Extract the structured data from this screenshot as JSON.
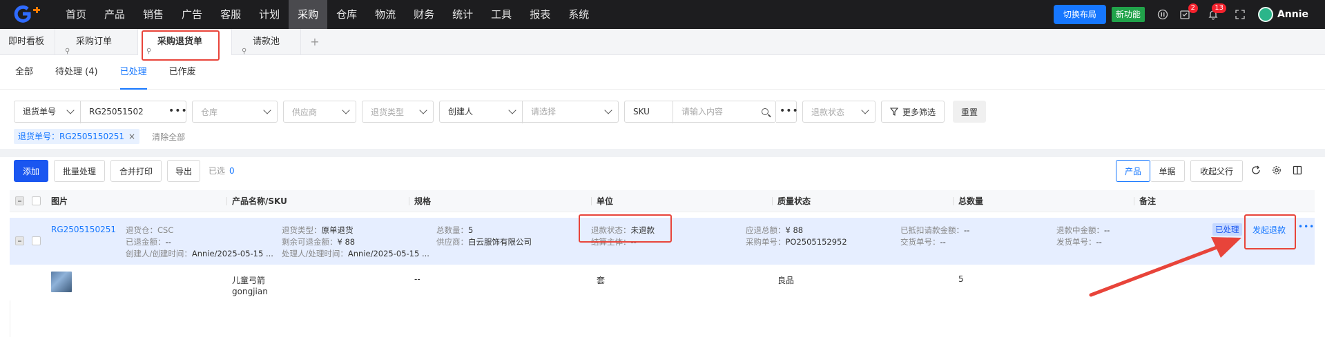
{
  "nav": {
    "items": [
      "首页",
      "产品",
      "销售",
      "广告",
      "客服",
      "计划",
      "采购",
      "仓库",
      "物流",
      "财务",
      "统计",
      "工具",
      "报表",
      "系统"
    ],
    "active_index": 6
  },
  "top_right": {
    "layout_btn": "切换布局",
    "new_feature": "新功能",
    "badge_tasks": "2",
    "badge_notices": "13",
    "user": "Annie"
  },
  "tabs": {
    "dashboard": "即时看板",
    "purchase_order": "采购订单",
    "purchase_return": "采购退货单",
    "payment_pool": "请款池",
    "plus": "+"
  },
  "subtabs": {
    "all": "全部",
    "pending": "待处理 (4)",
    "processed": "已处理",
    "voided": "已作废"
  },
  "filters": {
    "return_no_field": "退货单号",
    "return_no_value": "RG25051502",
    "dots": "•••",
    "warehouse": "仓库",
    "supplier": "供应商",
    "return_type": "退货类型",
    "creator": "创建人",
    "choose": "请选择",
    "sku": "SKU",
    "input_placeholder": "请输入内容",
    "refund_status": "退款状态",
    "more": "更多筛选",
    "reset": "重置"
  },
  "active_tag": {
    "label": "退货单号：RG2505150251",
    "close": "×",
    "clear_all": "清除全部"
  },
  "actions": {
    "add": "添加",
    "batch": "批量处理",
    "merge_print": "合并打印",
    "export": "导出",
    "selected_label": "已选",
    "selected_count": "0",
    "view_product": "产品",
    "view_order": "单据",
    "collapse": "收起父行"
  },
  "table": {
    "headers": [
      "图片",
      "产品名称/SKU",
      "规格",
      "单位",
      "质量状态",
      "总数量",
      "备注"
    ]
  },
  "group": {
    "order_no": "RG2505150251",
    "warehouse": "退货仓：CSC",
    "refunded_label": "已退金额：",
    "refunded_value": "--",
    "creator_label": "创建人/创建时间：",
    "creator_value": "Annie/2025-05-15 ...",
    "return_type_label": "退货类型：",
    "return_type_value": "原单退货",
    "refundable_label": "剩余可退金额：",
    "refundable_value": "¥ 88",
    "handler_label": "处理人/处理时间：",
    "handler_value": "Annie/2025-05-15 ...",
    "total_qty_label": "总数量：",
    "total_qty_value": "5",
    "supplier_label": "供应商：",
    "supplier_value": "白云服饰有限公司",
    "refund_status_label": "退款状态：",
    "refund_status_value": "未退款",
    "settle_label": "结算主体：",
    "settle_value": "--",
    "amount_due_label": "应退总额：",
    "amount_due_value": "¥ 88",
    "po_label": "采购单号：",
    "po_value": "PO2505152952",
    "deducted_label": "已抵扣请款金额：",
    "deducted_value": "--",
    "delivery_label": "交货单号：",
    "delivery_value": "--",
    "refunding_label": "退款中金额：",
    "refunding_value": "--",
    "ship_label": "发货单号：",
    "ship_value": "--",
    "status_badge": "已处理",
    "initiate_refund": "发起退款",
    "more": "•••"
  },
  "item": {
    "name": "儿童弓箭",
    "sku": "gongjian",
    "spec": "--",
    "unit": "套",
    "quality": "良品",
    "qty": "5"
  },
  "colors": {
    "accent": "#1677ff",
    "topbar": "#1d1d1f",
    "highlight_red": "#e8443a",
    "row_highlight": "#e6eeff"
  }
}
